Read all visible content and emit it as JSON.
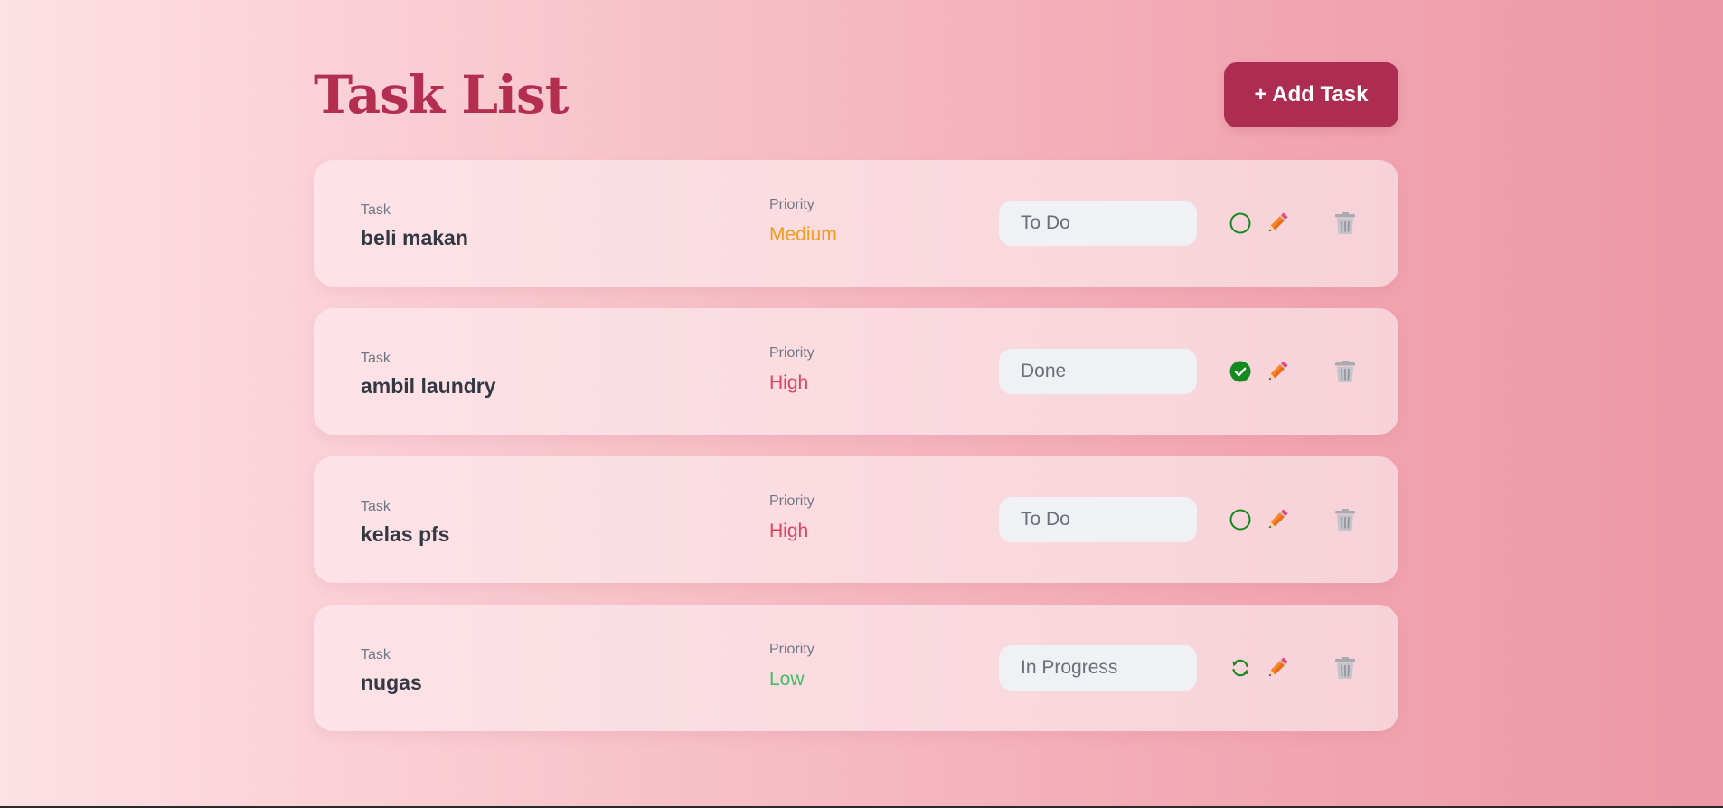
{
  "header": {
    "title": "Task List",
    "add_button_label": "+ Add Task"
  },
  "labels": {
    "task": "Task",
    "priority": "Priority"
  },
  "tasks": [
    {
      "name": "beli makan",
      "priority": "Medium",
      "status": "To Do",
      "status_icon": "empty-circle-icon"
    },
    {
      "name": "ambil laundry",
      "priority": "High",
      "status": "Done",
      "status_icon": "check-circle-icon"
    },
    {
      "name": "kelas pfs",
      "priority": "High",
      "status": "To Do",
      "status_icon": "empty-circle-icon"
    },
    {
      "name": "nugas",
      "priority": "Low",
      "status": "In Progress",
      "status_icon": "refresh-icon"
    }
  ],
  "colors": {
    "accent": "#ac2c52",
    "title": "#b42e52",
    "priority_medium": "#f39c1a",
    "priority_high": "#e0435c",
    "priority_low": "#3fbf62",
    "status_green": "#138a1e"
  }
}
